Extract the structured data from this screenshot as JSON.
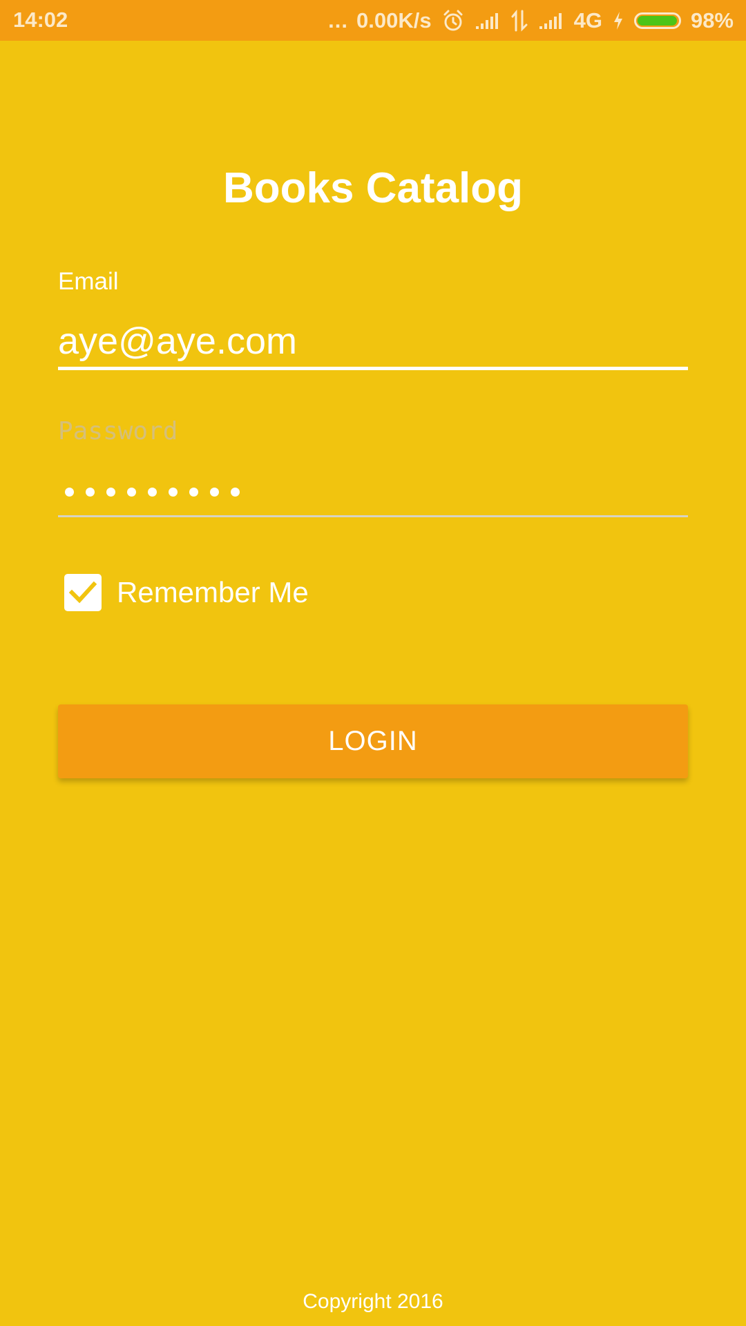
{
  "status_bar": {
    "time": "14:02",
    "dots": "...",
    "network_speed": "0.00K/s",
    "network_type": "4G",
    "battery_percent": "98%",
    "battery_level": 0.98,
    "battery_color": "#4CC417",
    "icons": [
      "alarm-icon",
      "signal-icon",
      "data-transfer-icon",
      "signal-icon",
      "charging-icon",
      "battery-icon"
    ]
  },
  "app": {
    "title": "Books Catalog",
    "background_color": "#F1C40F",
    "accent_color": "#F39C12"
  },
  "form": {
    "email_label": "Email",
    "email_value": "aye@aye.com",
    "password_label": "Password",
    "password_mask_count": 9,
    "remember_label": "Remember Me",
    "remember_checked": true,
    "login_label": "LOGIN"
  },
  "footer": {
    "copyright": "Copyright 2016"
  }
}
